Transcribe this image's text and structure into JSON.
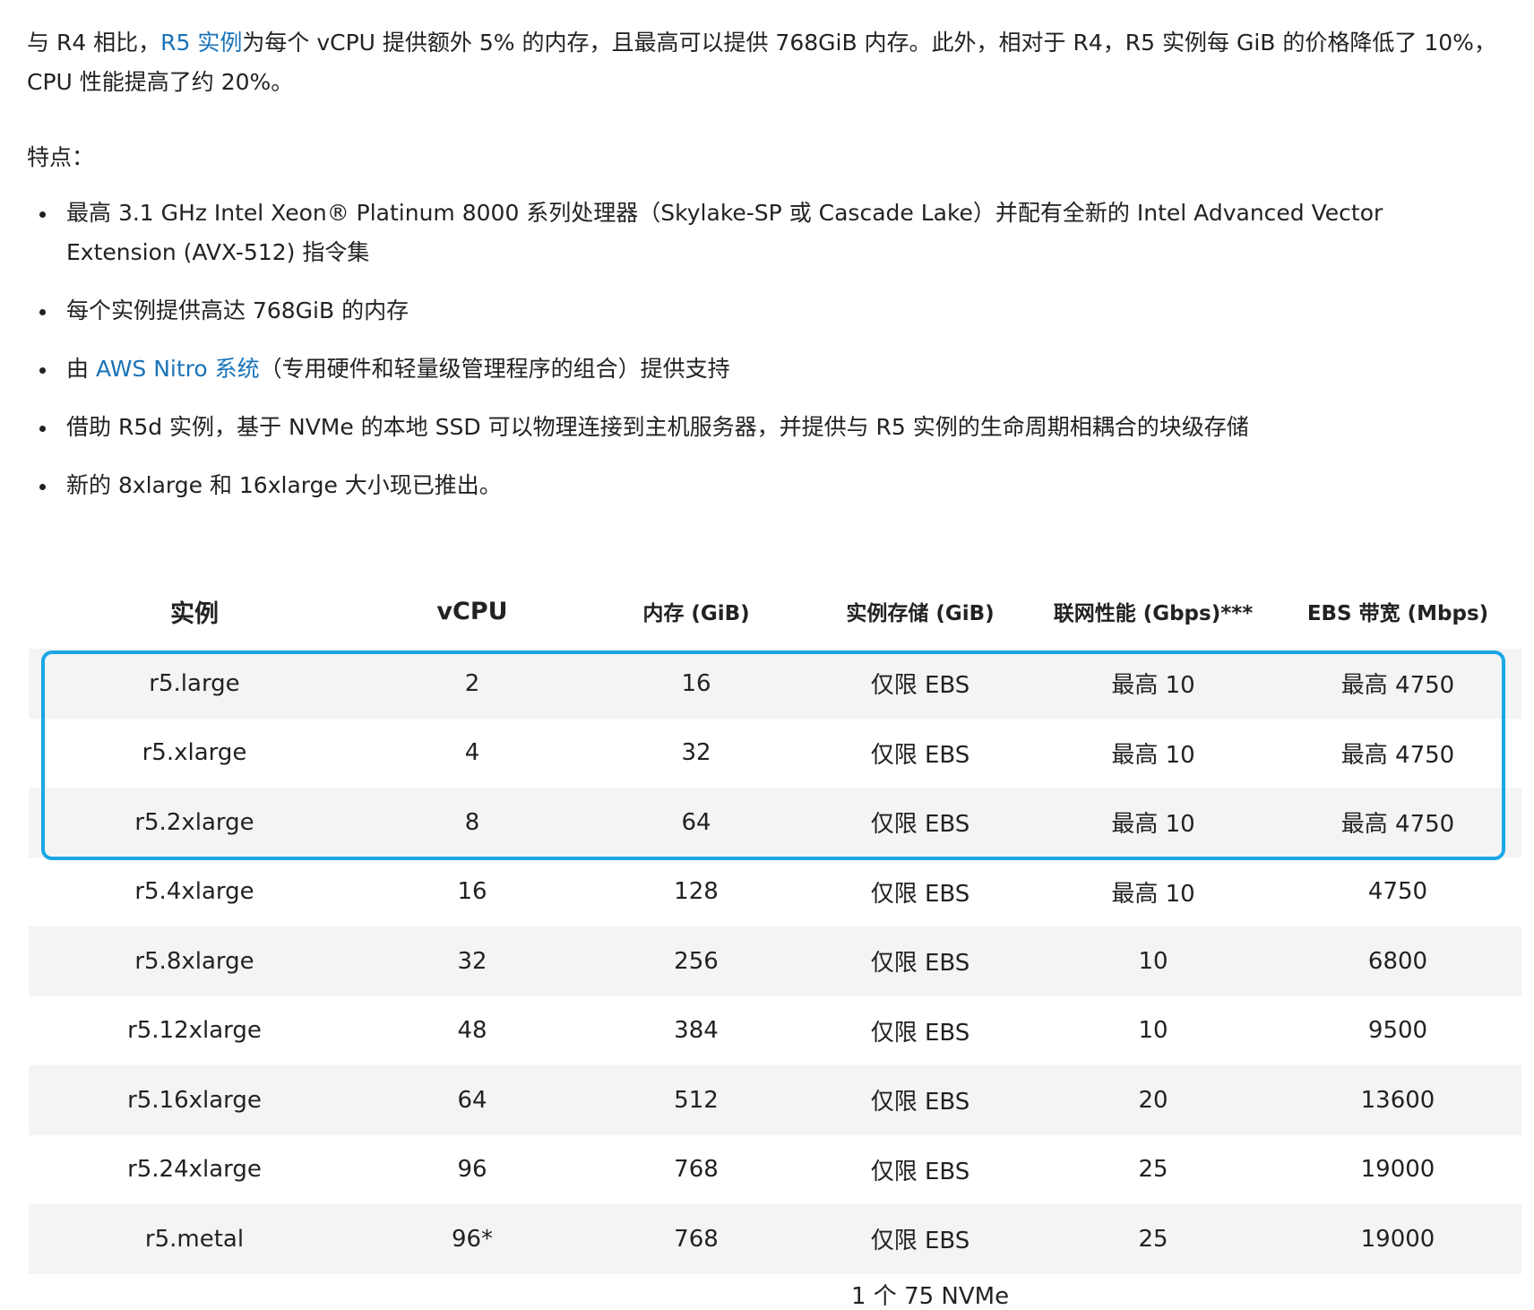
{
  "intro": {
    "prefix": "与 R4 相比，",
    "link_text": "R5 实例",
    "suffix": "为每个 vCPU 提供额外 5% 的内存，且最高可以提供 768GiB 内存。此外，相对于 R4，R5 实例每 GiB 的价格降低了 10%，CPU 性能提高了约 20%。"
  },
  "features": {
    "title": "特点：",
    "items": [
      "最高 3.1 GHz Intel Xeon® Platinum 8000 系列处理器（Skylake-SP 或 Cascade Lake）并配有全新的 Intel Advanced Vector Extension (AVX-512) 指令集",
      "每个实例提供高达 768GiB 的内存",
      "借助 R5d 实例，基于 NVMe 的本地 SSD 可以物理连接到主机服务器，并提供与 R5 实例的生命周期相耦合的块级存储",
      "新的 8xlarge 和 16xlarge 大小现已推出。"
    ],
    "nitro_item": {
      "prefix": "由 ",
      "link_text": "AWS Nitro 系统",
      "suffix": "（专用硬件和轻量级管理程序的组合）提供支持"
    }
  },
  "table": {
    "headers": [
      "实例",
      "vCPU",
      "内存 (GiB)",
      "实例存储 (GiB)",
      "联网性能 (Gbps)***",
      "EBS 带宽 (Mbps)"
    ],
    "rows": [
      [
        "r5.large",
        "2",
        "16",
        "仅限 EBS",
        "最高 10",
        "最高 4750"
      ],
      [
        "r5.xlarge",
        "4",
        "32",
        "仅限 EBS",
        "最高 10",
        "最高 4750"
      ],
      [
        "r5.2xlarge",
        "8",
        "64",
        "仅限 EBS",
        "最高 10",
        "最高 4750"
      ],
      [
        "r5.4xlarge",
        "16",
        "128",
        "仅限 EBS",
        "最高 10",
        "4750"
      ],
      [
        "r5.8xlarge",
        "32",
        "256",
        "仅限 EBS",
        "10",
        "6800"
      ],
      [
        "r5.12xlarge",
        "48",
        "384",
        "仅限 EBS",
        "10",
        "9500"
      ],
      [
        "r5.16xlarge",
        "64",
        "512",
        "仅限 EBS",
        "20",
        "13600"
      ],
      [
        "r5.24xlarge",
        "96",
        "768",
        "仅限 EBS",
        "25",
        "19000"
      ],
      [
        "r5.metal",
        "96*",
        "768",
        "仅限 EBS",
        "25",
        "19000"
      ]
    ],
    "partial_next_row_text": "1 个 75 NVMe",
    "highlight_color": "#1aa7e6"
  }
}
